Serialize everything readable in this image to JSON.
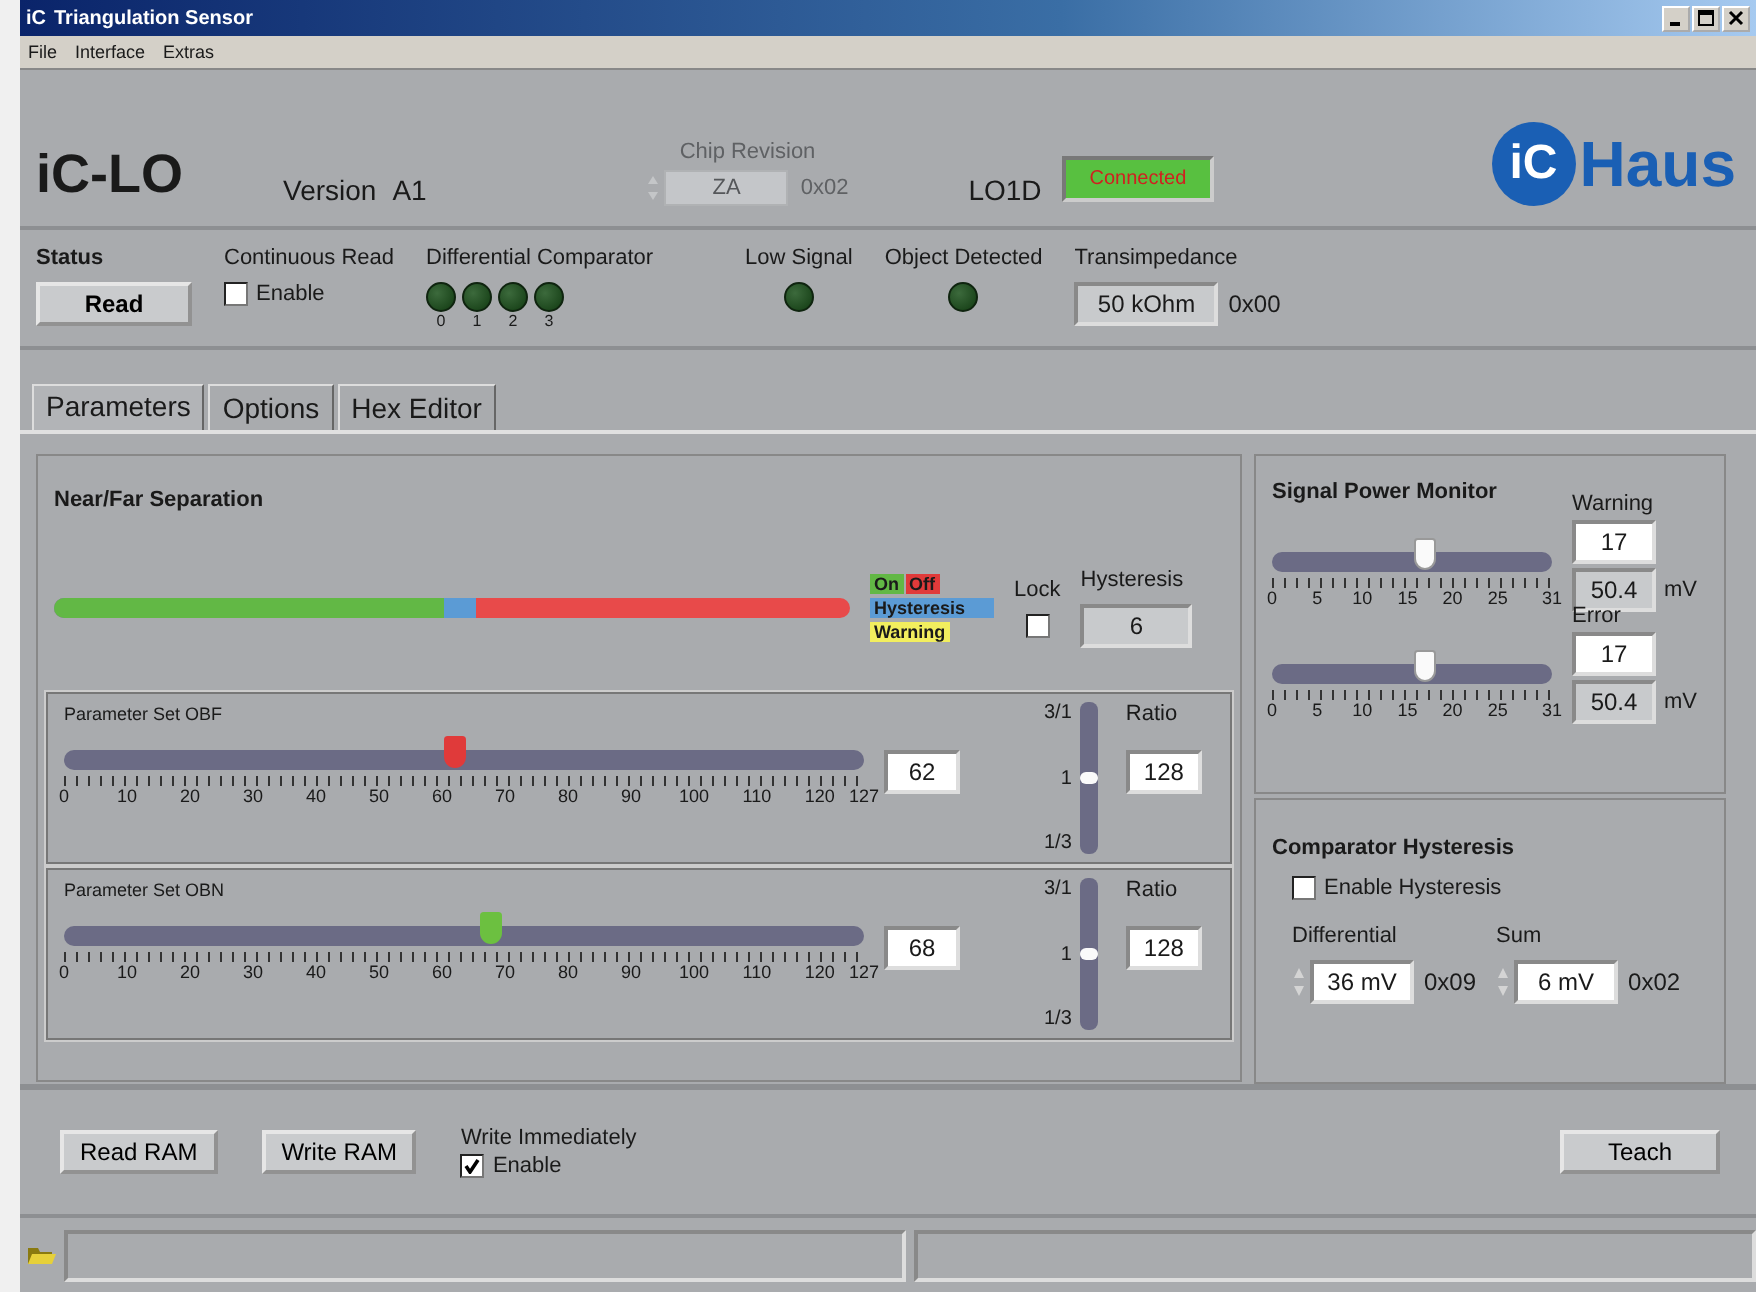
{
  "window": {
    "title_icon": "iC",
    "title": "Triangulation Sensor"
  },
  "menu": [
    "File",
    "Interface",
    "Extras"
  ],
  "header": {
    "product": "iC-LO",
    "version_label": "Version",
    "version": "A1",
    "chip_revision": {
      "label": "Chip Revision",
      "value": "ZA",
      "hex": "0x02",
      "disabled": true
    },
    "device": "LO1D",
    "connection": {
      "text": "Connected",
      "connected": true
    },
    "logo": {
      "mark": "iC",
      "name": "Haus"
    }
  },
  "status": {
    "title": "Status",
    "read_button": "Read",
    "continuous_read": {
      "label": "Continuous Read",
      "checkbox": "Enable",
      "checked": false
    },
    "differential_comparator": {
      "label": "Differential Comparator",
      "leds": [
        {
          "label": "0",
          "on": false
        },
        {
          "label": "1",
          "on": false
        },
        {
          "label": "2",
          "on": false
        },
        {
          "label": "3",
          "on": false
        }
      ]
    },
    "low_signal": {
      "label": "Low Signal",
      "on": false
    },
    "object_detected": {
      "label": "Object Detected",
      "on": false
    },
    "transimpedance": {
      "label": "Transimpedance",
      "value": "50 kOhm",
      "hex": "0x00"
    }
  },
  "tabs": [
    {
      "label": "Parameters",
      "selected": true
    },
    {
      "label": "Options",
      "selected": false
    },
    {
      "label": "Hex Editor",
      "selected": false
    }
  ],
  "near_far": {
    "title": "Near/Far Separation",
    "bar": {
      "color": "#e84a4a",
      "fills": [
        {
          "color": "#5b9bd5",
          "level": 0.53
        },
        {
          "color": "#62b845",
          "level": 0.49
        }
      ]
    },
    "legend": [
      {
        "label": "On",
        "color": "#62b845"
      },
      {
        "label": "Off",
        "color": "#e03a3a"
      },
      {
        "label": "Hysteresis",
        "color": "#5b9bd5"
      },
      {
        "label": "Warning",
        "color": "#f2ee5e"
      }
    ],
    "lock": {
      "label": "Lock",
      "checked": false
    },
    "hysteresis": {
      "label": "Hysteresis",
      "value": "6"
    }
  },
  "parameter_sets": [
    {
      "title": "Parameter Set OBF",
      "level": 0.488,
      "color": "#e03a3a",
      "value": "62",
      "ticks": [
        "0",
        "10",
        "20",
        "30",
        "40",
        "50",
        "60",
        "70",
        "80",
        "90",
        "100",
        "110",
        "120",
        "127"
      ],
      "ratio": {
        "label": "Ratio",
        "scale": [
          "3/1",
          "1",
          "1/3"
        ],
        "level": 0.5,
        "value": "128"
      }
    },
    {
      "title": "Parameter Set OBN",
      "level": 0.535,
      "color": "#6cc040",
      "value": "68",
      "ticks": [
        "0",
        "10",
        "20",
        "30",
        "40",
        "50",
        "60",
        "70",
        "80",
        "90",
        "100",
        "110",
        "120",
        "127"
      ],
      "ratio": {
        "label": "Ratio",
        "scale": [
          "3/1",
          "1",
          "1/3"
        ],
        "level": 0.5,
        "value": "128"
      }
    }
  ],
  "signal_power_monitor": {
    "title": "Signal Power Monitor",
    "sliders": [
      {
        "label": "Warning",
        "level": 0.548,
        "value": "17",
        "reading": "50.4",
        "unit": "mV",
        "ticks": [
          "0",
          "5",
          "10",
          "15",
          "20",
          "25",
          "31"
        ]
      },
      {
        "label": "Error",
        "level": 0.548,
        "value": "17",
        "reading": "50.4",
        "unit": "mV",
        "ticks": [
          "0",
          "5",
          "10",
          "15",
          "20",
          "25",
          "31"
        ]
      }
    ]
  },
  "comparator_hysteresis": {
    "title": "Comparator Hysteresis",
    "enable": {
      "label": "Enable Hysteresis",
      "checked": false
    },
    "fields": [
      {
        "label": "Differential",
        "value": "36 mV",
        "hex": "0x09"
      },
      {
        "label": "Sum",
        "value": "6 mV",
        "hex": "0x02"
      }
    ]
  },
  "footer": {
    "buttons": [
      "Read RAM",
      "Write RAM"
    ],
    "write_immediately": {
      "label": "Write Immediately",
      "checkbox": "Enable",
      "checked": true
    },
    "teach": "Teach"
  }
}
